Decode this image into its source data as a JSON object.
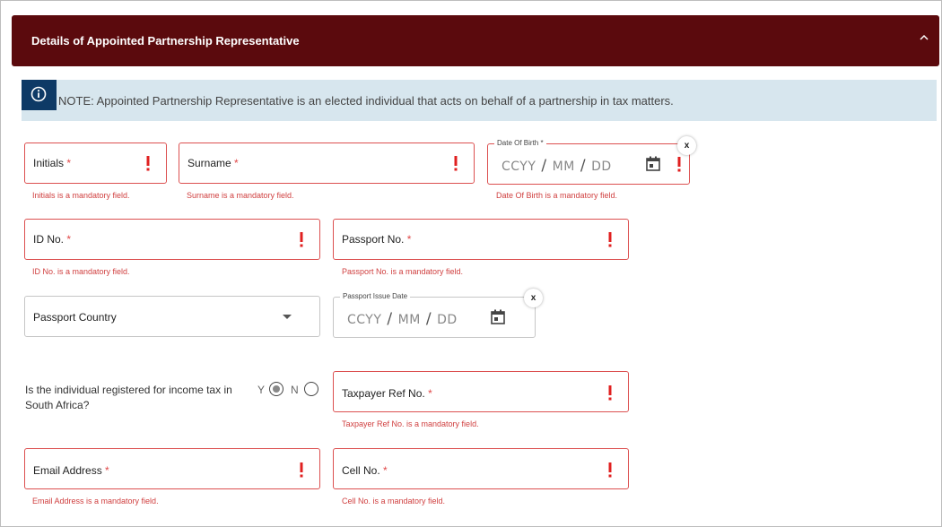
{
  "panel": {
    "title": "Details of Appointed Partnership Representative"
  },
  "note": {
    "text": "NOTE: Appointed Partnership Representative is an elected individual that acts on behalf of a partnership in tax matters."
  },
  "fields": {
    "initials": {
      "label": "Initials",
      "required": "*",
      "error": "Initials is a mandatory field."
    },
    "surname": {
      "label": "Surname",
      "required": "*",
      "error": "Surname is a mandatory field."
    },
    "dob": {
      "label": "Date Of Birth *",
      "placeholder_year": "CCYY",
      "placeholder_month": "MM",
      "placeholder_day": "DD",
      "separator": "/",
      "error": "Date Of Birth is a mandatory field.",
      "clear": "x"
    },
    "id_no": {
      "label": "ID No.",
      "required": "*",
      "error": "ID No. is a mandatory field."
    },
    "passport_no": {
      "label": "Passport No.",
      "required": "*",
      "error": "Passport No. is a mandatory field."
    },
    "passport_country": {
      "label": "Passport Country"
    },
    "passport_issue_date": {
      "label": "Passport Issue Date",
      "placeholder_year": "CCYY",
      "placeholder_month": "MM",
      "placeholder_day": "DD",
      "separator": "/",
      "clear": "x"
    },
    "income_tax_question": {
      "text": "Is the individual registered for income tax in South Africa?",
      "yes": "Y",
      "no": "N",
      "selected": "Y"
    },
    "taxpayer_ref": {
      "label": "Taxpayer Ref No.",
      "required": "*",
      "error": "Taxpayer Ref No. is a mandatory field."
    },
    "email": {
      "label": "Email Address",
      "required": "*",
      "error": "Email Address is a mandatory field."
    },
    "cell": {
      "label": "Cell No.",
      "required": "*",
      "error": "Cell No. is a mandatory field."
    }
  },
  "colors": {
    "header_bg": "#5b0a0d",
    "note_bg": "#d7e6ee",
    "info_icon_bg": "#0e3a66",
    "error_red": "#dc5050"
  },
  "icons": [
    "chevron-up-icon",
    "info-icon",
    "exclamation-icon",
    "calendar-icon",
    "dropdown-caret-icon",
    "clear-icon"
  ]
}
